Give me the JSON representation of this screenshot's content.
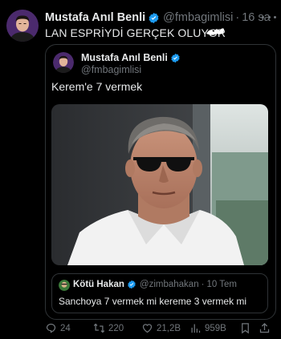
{
  "tweet": {
    "author": {
      "name": "Mustafa Anıl Benli",
      "handle": "@fmbagimlisi",
      "verified": true,
      "avatar_icon": "profile-avatar"
    },
    "time": "16 sa",
    "separator": "·",
    "text": "LAN ESPRİYDİ GERÇEK OLUYOR",
    "more_icon": "more-horizontal-icon"
  },
  "quote": {
    "author": {
      "name": "Mustafa Anıl Benli",
      "handle": "@fmbagimlisi",
      "verified": true
    },
    "text": "Kerem'e 7 vermek",
    "image_description_icon": "photo-man-sunglasses",
    "nested": {
      "author": {
        "name": "Kötü Hakan",
        "handle": "@zimbahakan",
        "verified": true
      },
      "time": "10 Tem",
      "separator": "·",
      "text": "Sanchoya 7 vermek mi kereme 3 vermek mi"
    }
  },
  "actions": {
    "replies": "24",
    "retweets": "220",
    "likes": "21,2B",
    "views": "959B"
  },
  "colors": {
    "background": "#000000",
    "text": "#e7e9ea",
    "muted": "#71767b",
    "border": "#2f3336",
    "verified_badge": "#1d9bf0"
  }
}
